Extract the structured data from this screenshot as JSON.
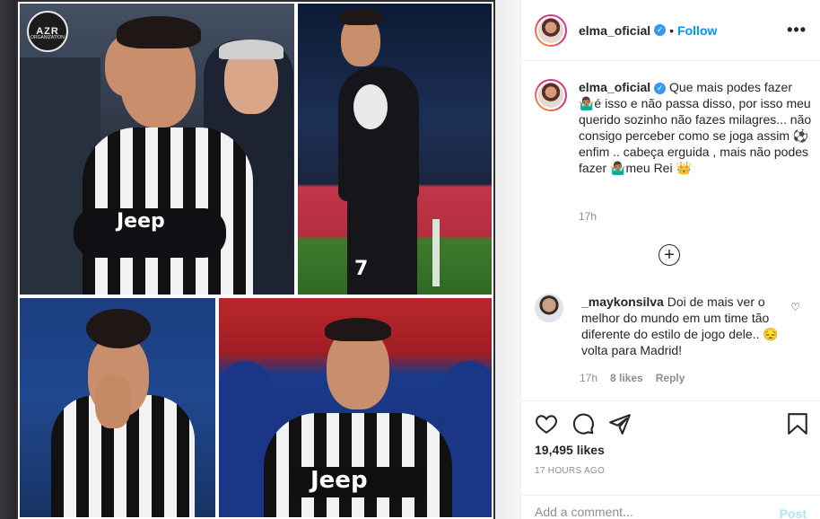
{
  "post": {
    "author": "elma_oficial",
    "verified_icon": "verified-badge-icon",
    "separator": "•",
    "follow_label": "Follow",
    "more_options": "•••",
    "caption": {
      "username": "elma_oficial",
      "text": "Que mais podes fazer 🤷🏽‍♂️é isso e não passa disso, por isso meu querido sozinho não fazes milagres... não consigo perceber como se joga assim ⚽enfim .. cabeça erguida , mais não podes fazer 🤷🏽‍♂️meu Rei 👑",
      "time": "17h"
    },
    "load_more": "+",
    "comment": {
      "username": "_maykonsilva",
      "text": "Doi de mais ver o melhor do mundo em um time tão diferente do estilo de jogo dele.. 😔 volta para Madrid!",
      "time": "17h",
      "likes": "8 likes",
      "reply": "Reply",
      "heart": "♡"
    },
    "likes": "19,495 likes",
    "posted": "17 HOURS AGO",
    "add_comment_placeholder": "Add a comment...",
    "post_button": "Post"
  },
  "collage": {
    "logo_text": "AZR",
    "logo_subtext": "ORGANIZATION",
    "sponsor": "Jeep",
    "shirt_number": "7"
  },
  "icons": {
    "like": "heart-icon",
    "comment": "comment-icon",
    "share": "share-icon",
    "save": "bookmark-icon"
  },
  "colors": {
    "accent": "#0095f6",
    "muted": "#8e8e8e",
    "text": "#262626",
    "post_disabled": "#b2dffc"
  }
}
